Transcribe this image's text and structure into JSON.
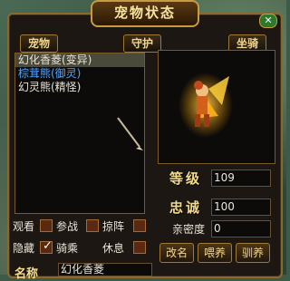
{
  "window": {
    "title": "宠物状态",
    "close_label": "✕"
  },
  "tabs": [
    {
      "label": "宠物"
    },
    {
      "label": "守护"
    },
    {
      "label": "坐骑"
    }
  ],
  "pet_list": [
    {
      "label": "幻化香菱(变异)",
      "selected": true,
      "color": "#e8e4d8"
    },
    {
      "label": "棕茸熊(御灵)",
      "selected": false,
      "color": "#4fa4ff"
    },
    {
      "label": "幻灵熊(精怪)",
      "selected": false,
      "color": "#e8e4d8"
    }
  ],
  "stats": {
    "level_label": "等级",
    "level_value": "109",
    "loyalty_label": "忠诚",
    "loyalty_value": "100",
    "intimacy_label": "亲密度",
    "intimacy_value": "0"
  },
  "checkboxes": [
    {
      "label": "观看",
      "checked": false
    },
    {
      "label": "参战",
      "checked": false
    },
    {
      "label": "掠阵",
      "checked": false
    },
    {
      "label": "隐藏",
      "checked": false
    },
    {
      "label": "骑乘",
      "checked": true
    },
    {
      "label": "休息",
      "checked": false
    }
  ],
  "buttons": {
    "rename": "改名",
    "feed": "喂养",
    "tame": "驯养"
  },
  "name_field": {
    "label": "名称",
    "value": "幻化香菱"
  }
}
